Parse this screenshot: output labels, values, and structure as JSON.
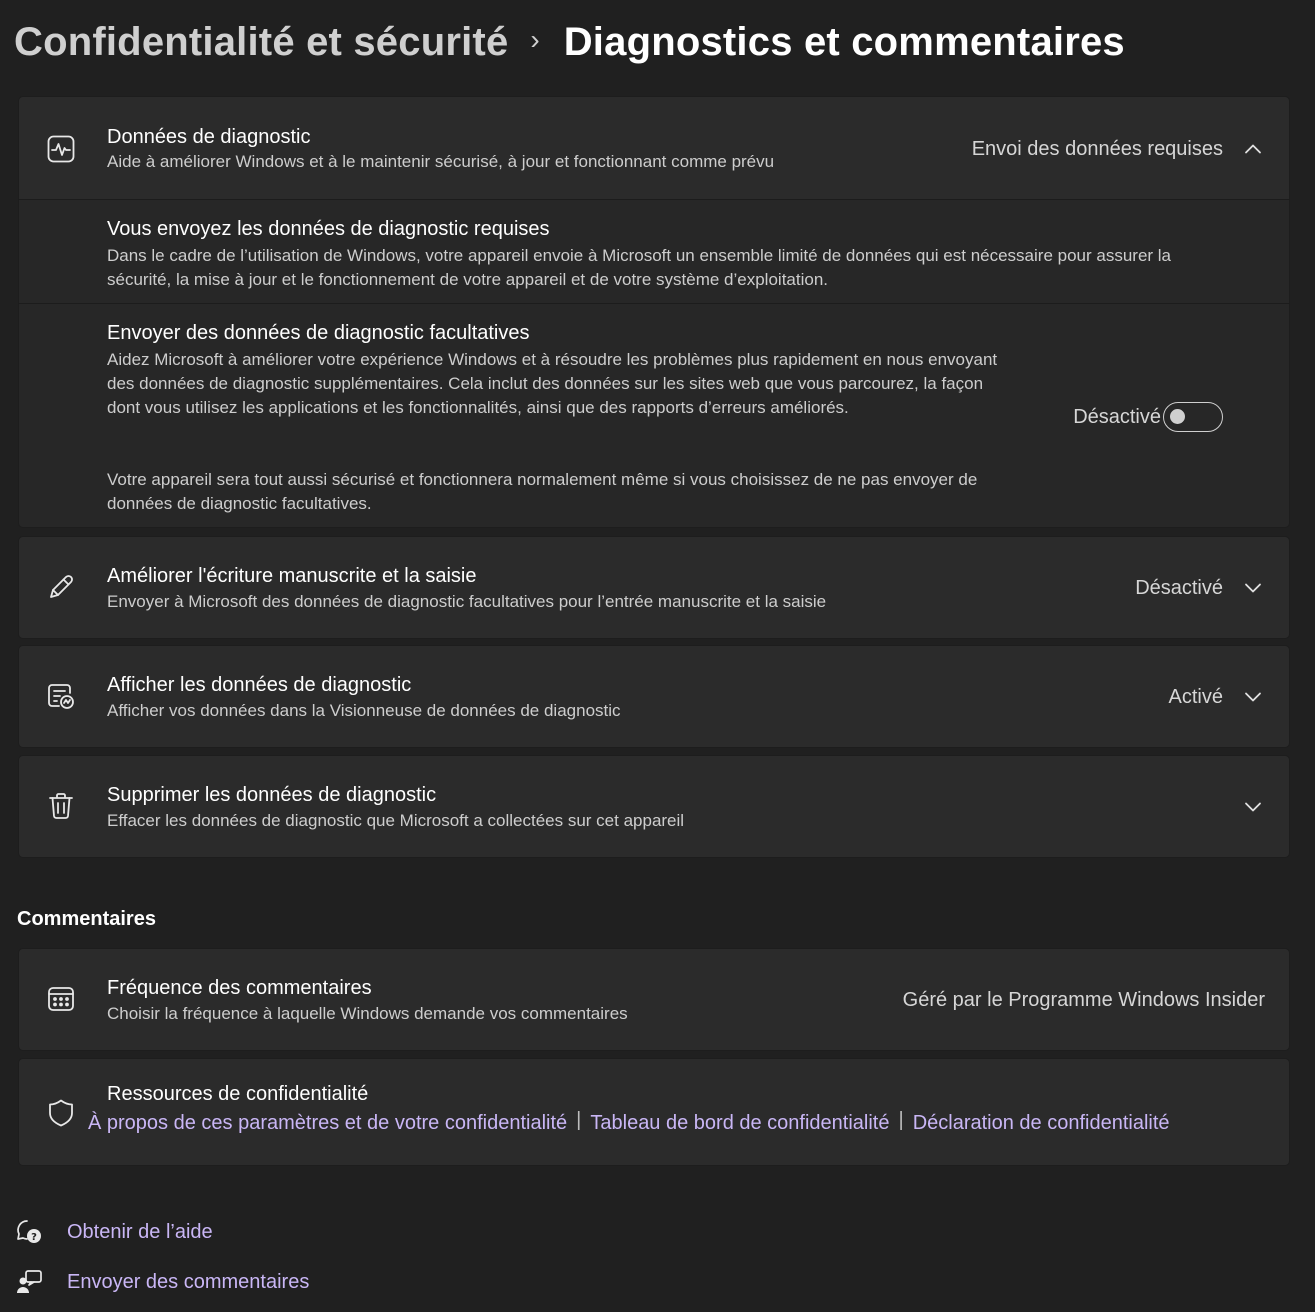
{
  "breadcrumb": {
    "parent": "Confidentialité et sécurité",
    "separator": "›",
    "current": "Diagnostics et commentaires"
  },
  "diagnostic": {
    "title": "Données de diagnostic",
    "subtitle": "Aide à améliorer Windows et à le maintenir sécurisé, à jour et fonctionnant comme prévu",
    "status": "Envoi des données requises",
    "expanded": true,
    "required": {
      "title": "Vous envoyez les données de diagnostic requises",
      "description": "Dans le cadre de l’utilisation de Windows, votre appareil envoie à Microsoft un ensemble limité de données qui est nécessaire pour assurer la sécurité, la mise à jour et le fonctionnement de votre appareil et de votre système d’exploitation."
    },
    "optional": {
      "title": "Envoyer des données de diagnostic facultatives",
      "description": "Aidez Microsoft à améliorer votre expérience Windows et à résoudre les problèmes plus rapidement en nous envoyant des données de diagnostic supplémentaires. Cela inclut des données sur les sites web que vous parcourez, la façon dont vous utilisez les applications et les fonctionnalités, ainsi que des rapports d’erreurs améliorés.",
      "note": "Votre appareil sera tout aussi sécurisé et fonctionnera normalement même si vous choisissez de ne pas envoyer de données de diagnostic facultatives.",
      "toggle_label": "Désactivé",
      "toggle_on": false
    }
  },
  "handwriting": {
    "title": "Améliorer l'écriture manuscrite et la saisie",
    "subtitle": "Envoyer à Microsoft des données de diagnostic facultatives pour l’entrée manuscrite et la saisie",
    "status": "Désactivé"
  },
  "view_data": {
    "title": "Afficher les données de diagnostic",
    "subtitle": "Afficher vos données dans la Visionneuse de données de diagnostic",
    "status": "Activé"
  },
  "delete_data": {
    "title": "Supprimer les données de diagnostic",
    "subtitle": "Effacer les données de diagnostic que Microsoft a collectées sur cet appareil"
  },
  "feedback_section": {
    "title": "Commentaires"
  },
  "feedback_frequency": {
    "title": "Fréquence des commentaires",
    "subtitle": "Choisir la fréquence à laquelle Windows demande vos commentaires",
    "status": "Géré par le Programme Windows Insider"
  },
  "privacy_resources": {
    "title": "Ressources de confidentialité",
    "links": [
      "À propos de ces paramètres et de votre confidentialité",
      "Tableau de bord de confidentialité",
      "Déclaration de confidentialité"
    ],
    "separator": "|"
  },
  "bottom": {
    "help": "Obtenir de l’aide",
    "feedback": "Envoyer des commentaires"
  },
  "colors": {
    "background": "#202020",
    "card": "#2b2b2b",
    "link": "#c9b6f5"
  },
  "icons": {
    "diagnostic": "heart-pulse-icon",
    "handwriting": "pen-icon",
    "view_data": "document-search-icon",
    "delete_data": "trash-icon",
    "feedback_frequency": "calendar-icon",
    "privacy_resources": "shield-icon",
    "help": "help-chat-icon",
    "feedback": "person-feedback-icon"
  }
}
